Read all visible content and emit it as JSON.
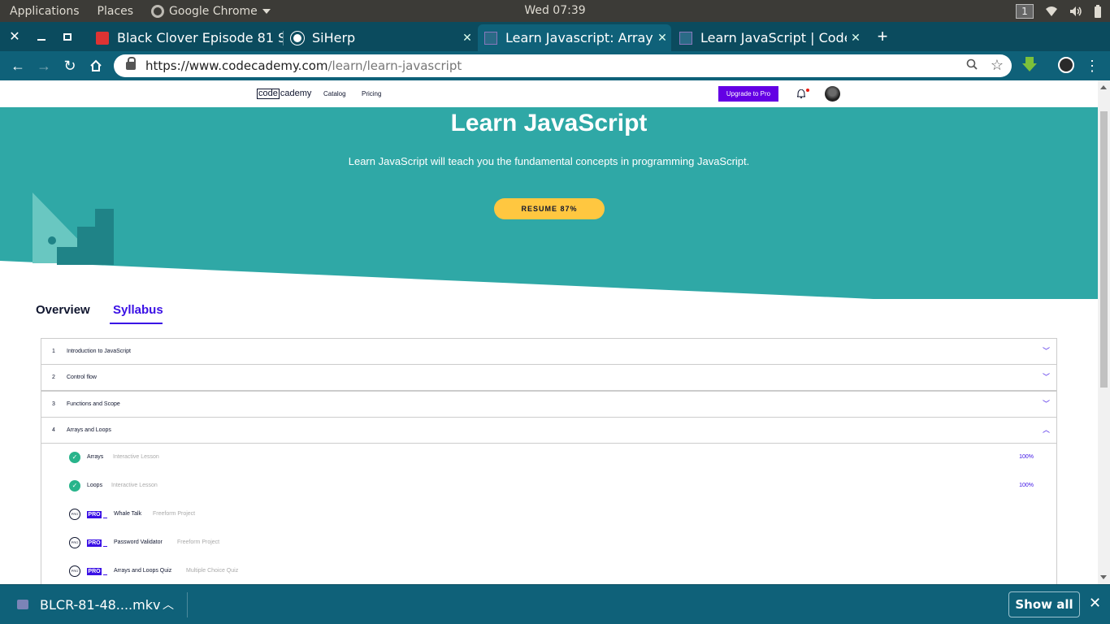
{
  "panel": {
    "applications": "Applications",
    "places": "Places",
    "chrome_label": "Google Chrome",
    "clock": "Wed 07:39",
    "workspace": "1"
  },
  "tabs": [
    {
      "title": "Black Clover Episode 81 S",
      "favicon": "black-clover-favicon"
    },
    {
      "title": "SiHerp",
      "favicon": "globe-favicon"
    },
    {
      "title": "Learn Javascript: Arrays, L",
      "favicon": "codecademy-favicon"
    },
    {
      "title": "Learn JavaScript | Codeca",
      "favicon": "codecademy-favicon"
    }
  ],
  "toolbar": {
    "url_host": "https://www.codecademy.com",
    "url_path": "/learn/learn-javascript"
  },
  "site": {
    "logo_boxed": "code",
    "logo_rest": "cademy",
    "nav_catalog": "Catalog",
    "nav_pricing": "Pricing",
    "upgrade": "Upgrade to Pro"
  },
  "hero": {
    "title": "Learn JavaScript",
    "subtitle": "Learn JavaScript will teach you the fundamental concepts in programming JavaScript.",
    "resume": "RESUME 87%",
    "bg_color": "#2fa8a6"
  },
  "course_tabs": {
    "overview": "Overview",
    "syllabus": "Syllabus"
  },
  "modules": [
    {
      "num": "1",
      "name": "Introduction to JavaScript",
      "expanded": false
    },
    {
      "num": "2",
      "name": "Control flow",
      "expanded": false
    },
    {
      "num": "3",
      "name": "Functions and Scope",
      "expanded": false
    },
    {
      "num": "4",
      "name": "Arrays and Loops",
      "expanded": true
    }
  ],
  "lessons": [
    {
      "name": "Arrays",
      "type": "Interactive Lesson",
      "progress": "100%",
      "pro": false
    },
    {
      "name": "Loops",
      "type": "Interactive Lesson",
      "progress": "100%",
      "pro": false
    },
    {
      "name": "Whale Talk",
      "type": "Freeform Project",
      "progress": "",
      "pro": true
    },
    {
      "name": "Password Validator",
      "type": "Freeform Project",
      "progress": "",
      "pro": true
    },
    {
      "name": "Arrays and Loops Quiz",
      "type": "Multiple Choice Quiz",
      "progress": "",
      "pro": true
    }
  ],
  "pro_badge": "PRO",
  "download": {
    "filename": "BLCR-81-48....mkv",
    "show_all": "Show all"
  }
}
